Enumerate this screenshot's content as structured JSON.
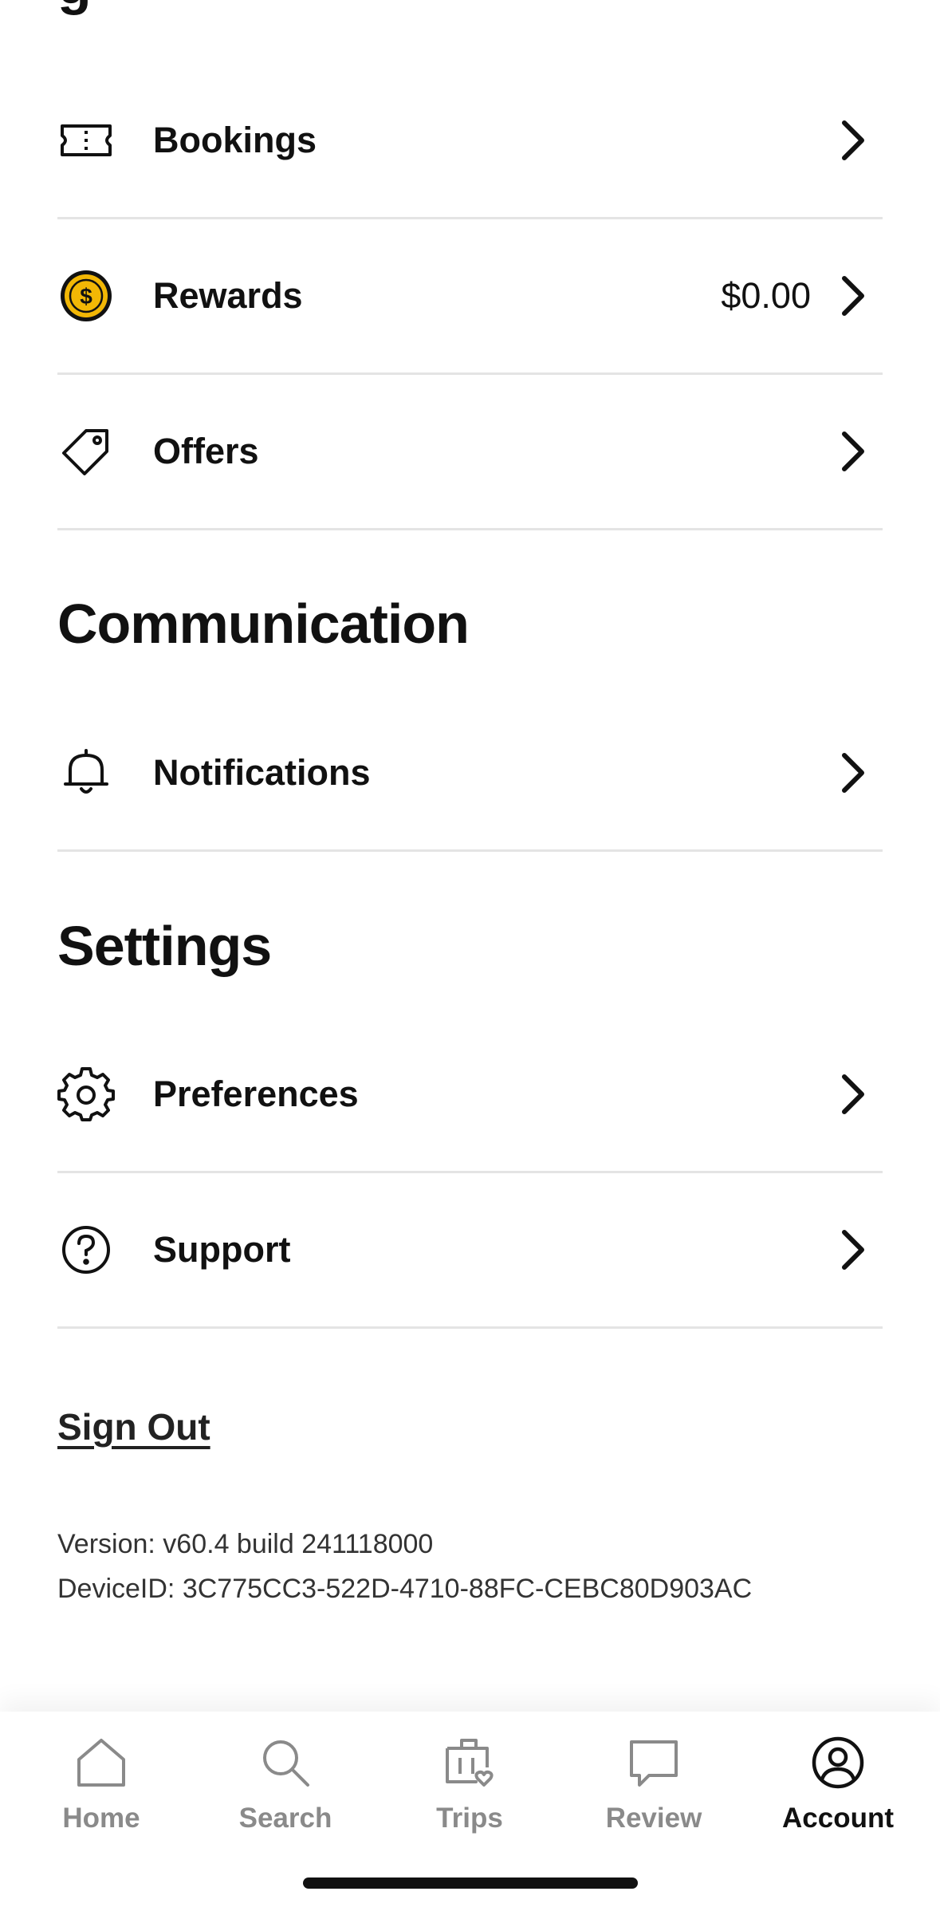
{
  "partial_heading": "g",
  "rows_top": [
    {
      "label": "Bookings",
      "value": "",
      "icon": "ticket-icon"
    },
    {
      "label": "Rewards",
      "value": "$0.00",
      "icon": "coin-icon"
    },
    {
      "label": "Offers",
      "value": "",
      "icon": "tag-icon"
    }
  ],
  "communication": {
    "title": "Communication",
    "notifications_label": "Notifications"
  },
  "settings": {
    "title": "Settings",
    "preferences_label": "Preferences",
    "support_label": "Support"
  },
  "sign_out": "Sign Out",
  "version": "Version: v60.4 build 241118000",
  "device_id": "DeviceID: 3C775CC3-522D-4710-88FC-CEBC80D903AC",
  "tabs": [
    {
      "label": "Home",
      "icon": "home-icon"
    },
    {
      "label": "Search",
      "icon": "search-icon"
    },
    {
      "label": "Trips",
      "icon": "suitcase-icon"
    },
    {
      "label": "Review",
      "icon": "review-icon"
    },
    {
      "label": "Account",
      "icon": "account-icon",
      "active": true
    }
  ],
  "colors": {
    "coin": "#f2b705",
    "active_tab": "#111111",
    "inactive_tab": "#8a8a8a",
    "divider": "#e4e4e4"
  }
}
